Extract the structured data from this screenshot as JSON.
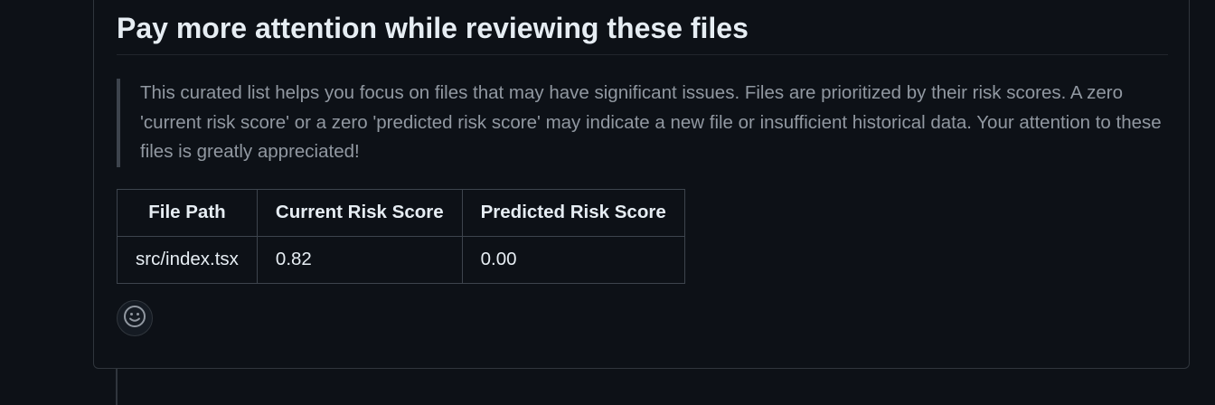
{
  "comment": {
    "heading": "Pay more attention while reviewing these files",
    "note": "This curated list helps you focus on files that may have significant issues. Files are prioritized by their risk scores. A zero 'current risk score' or a zero 'predicted risk score' may indicate a new file or insufficient historical data. Your attention to these files is greatly appreciated!",
    "table": {
      "headers": [
        "File Path",
        "Current Risk Score",
        "Predicted Risk Score"
      ],
      "rows": [
        [
          "src/index.tsx",
          "0.82",
          "0.00"
        ]
      ]
    },
    "reaction_icon": "smiley-icon"
  },
  "colors": {
    "background": "#0d1117",
    "border": "#30363d",
    "text": "#e6edf3",
    "muted_text": "#9198a1"
  }
}
